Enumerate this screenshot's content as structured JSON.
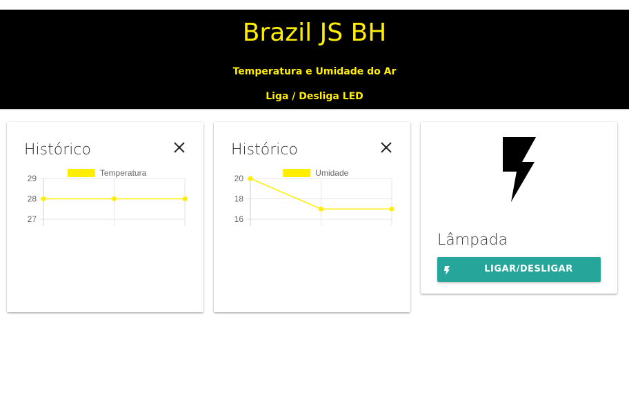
{
  "header": {
    "title": "Brazil JS BH",
    "nav": [
      "Temperatura e Umidade do Ar",
      "Liga / Desliga LED"
    ]
  },
  "colors": {
    "header_bg": "#000000",
    "accent": "#ffee00",
    "button": "#26a69a"
  },
  "cards": [
    {
      "title": "Histórico",
      "close_icon": "close-icon"
    },
    {
      "title": "Histórico",
      "close_icon": "close-icon"
    },
    {
      "title": "Lâmpada",
      "icon": "lightning-bolt-icon",
      "button_label": "LIGAR/DESLIGAR",
      "button_icon": "lightning-bolt-icon"
    }
  ],
  "chart_data": [
    {
      "type": "line",
      "series": [
        {
          "name": "Temperatura",
          "values": [
            28,
            28,
            28
          ]
        }
      ],
      "yticks": [
        29,
        28,
        27
      ],
      "ylim": [
        27,
        29
      ],
      "grid": true,
      "legend": "top-center"
    },
    {
      "type": "line",
      "series": [
        {
          "name": "Umidade",
          "values": [
            20,
            17,
            17
          ]
        }
      ],
      "yticks": [
        20,
        18,
        16
      ],
      "ylim": [
        16,
        20
      ],
      "grid": true,
      "legend": "top-center"
    }
  ]
}
